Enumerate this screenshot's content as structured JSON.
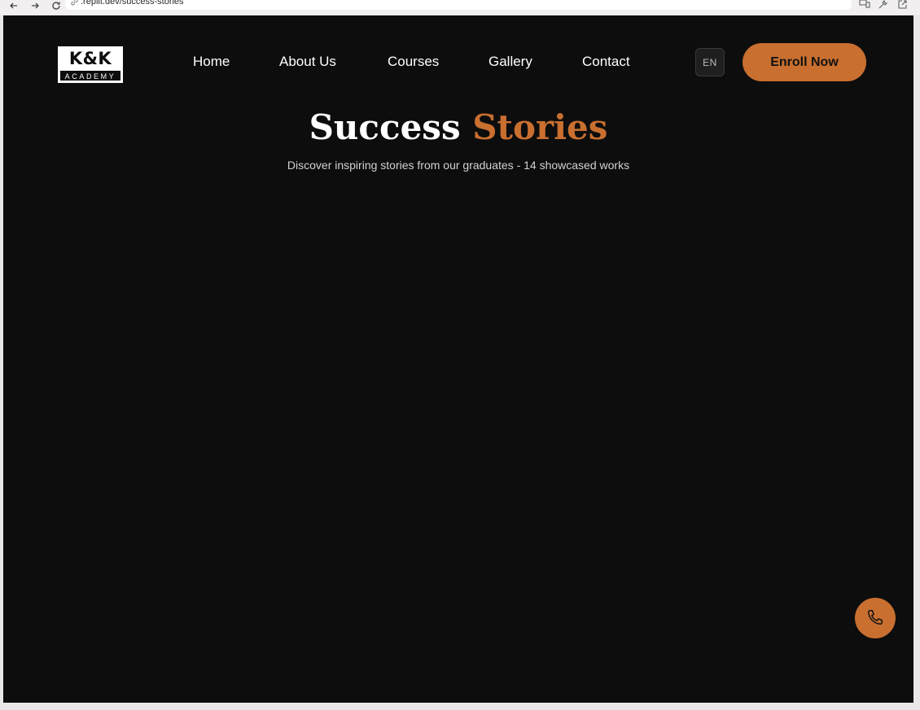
{
  "browser": {
    "url": ".replit.dev/success-stories",
    "icons": [
      "back-icon",
      "forward-icon",
      "reload-icon",
      "link-icon",
      "devices-icon",
      "tools-icon",
      "open-external-icon"
    ]
  },
  "header": {
    "logo": {
      "title": "K&K",
      "subtitle": "ACADEMY"
    },
    "nav": [
      {
        "label": "Home"
      },
      {
        "label": "About Us"
      },
      {
        "label": "Courses"
      },
      {
        "label": "Gallery"
      },
      {
        "label": "Contact"
      }
    ],
    "language": "EN",
    "cta": "Enroll Now"
  },
  "hero": {
    "title_part1": "Success",
    "title_part2": "Stories",
    "subtitle": "Discover inspiring stories from our graduates - 14 showcased works"
  },
  "floating": {
    "icon": "phone-icon"
  },
  "colors": {
    "background": "#0d0d0d",
    "accent": "#c96f30",
    "text": "#ffffff"
  }
}
